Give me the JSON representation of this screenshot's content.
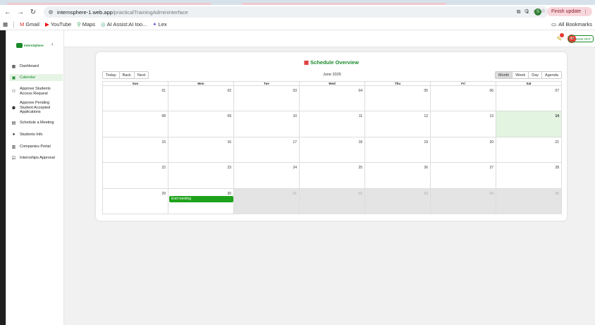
{
  "browser": {
    "url_host": "internsphere-1.web.app",
    "url_path": "/practicalTrainingAdmininterface",
    "finish_update_label": "Finish update",
    "profile_initial": "S",
    "bookmarks": [
      {
        "label": "Gmail"
      },
      {
        "label": "YouTube"
      },
      {
        "label": "Maps"
      },
      {
        "label": "AI Assist:AI too..."
      },
      {
        "label": "Lex"
      }
    ],
    "all_bookmarks_label": "All Bookmarks"
  },
  "sidebar": {
    "logo_text": "InternSphere",
    "items": [
      {
        "label": "Dashboard",
        "icon": "dashboard-icon",
        "active": false
      },
      {
        "label": "Calendar",
        "icon": "calendar-icon",
        "active": true
      },
      {
        "label": "Approve Students Access Request",
        "icon": "users-icon",
        "active": false
      },
      {
        "label": "Approve Pending Student Accepted Applications",
        "icon": "user-check-icon",
        "active": false
      },
      {
        "label": "Schedule a Meeting",
        "icon": "schedule-icon",
        "active": false
      },
      {
        "label": "Students Info",
        "icon": "info-icon",
        "active": false
      },
      {
        "label": "Companies Portal",
        "icon": "building-icon",
        "active": false
      },
      {
        "label": "Internships Approval",
        "icon": "check-square-icon",
        "active": false
      }
    ]
  },
  "header": {
    "avatar_initials": "IM",
    "sign_out_label": "SIGN OUT"
  },
  "calendar": {
    "title": "Schedule Overview",
    "month_label": "June 2025",
    "nav_buttons": [
      "Today",
      "Back",
      "Next"
    ],
    "view_buttons": [
      "Month",
      "Week",
      "Day",
      "Agenda"
    ],
    "active_view": "Month",
    "weekdays": [
      "Sun",
      "Mon",
      "Tue",
      "Wed",
      "Thu",
      "Fri",
      "Sat"
    ],
    "weeks": [
      [
        "01",
        "02",
        "03",
        "04",
        "05",
        "06",
        "07"
      ],
      [
        "08",
        "09",
        "10",
        "11",
        "12",
        "13",
        "14"
      ],
      [
        "15",
        "16",
        "17",
        "18",
        "19",
        "20",
        "21"
      ],
      [
        "22",
        "23",
        "24",
        "25",
        "26",
        "27",
        "28"
      ],
      [
        "29",
        "30",
        "01",
        "02",
        "03",
        "04",
        "05"
      ]
    ],
    "today": "14",
    "event": {
      "label": "End meeting",
      "day": "30"
    },
    "colors": {
      "accent": "#1b8a2b",
      "event": "#1ea21b",
      "today_bg": "#e3f4e1",
      "off_range_bg": "#e4e4e4"
    }
  }
}
